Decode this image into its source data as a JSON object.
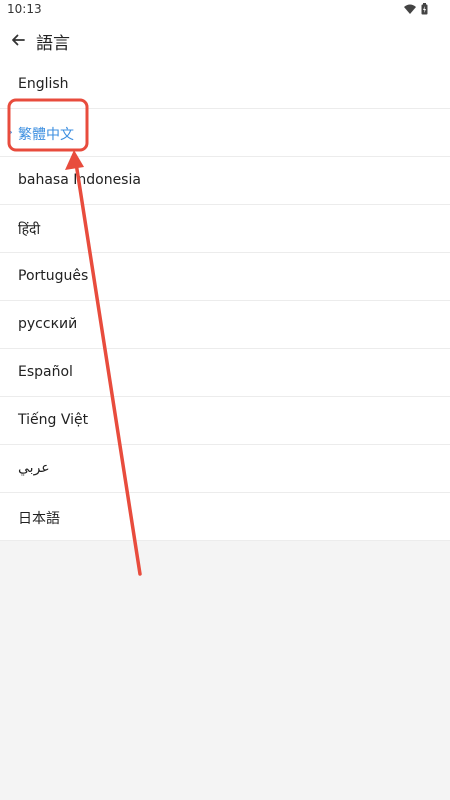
{
  "status_bar": {
    "time": "10:13"
  },
  "header": {
    "title": "語言",
    "back_icon": "arrow-left-icon"
  },
  "languages": [
    {
      "label": "English",
      "selected": false
    },
    {
      "label": "繁體中文",
      "selected": true
    },
    {
      "label": "bahasa Indonesia",
      "selected": false
    },
    {
      "label": "हिंदी",
      "selected": false
    },
    {
      "label": "Português",
      "selected": false
    },
    {
      "label": "русский",
      "selected": false
    },
    {
      "label": "Español",
      "selected": false
    },
    {
      "label": "Tiếng Việt",
      "selected": false
    },
    {
      "label": "عربي",
      "selected": false
    },
    {
      "label": "日本語",
      "selected": false
    }
  ],
  "colors": {
    "accent": "#3d8fe0",
    "annotation": "#e84c3d"
  }
}
